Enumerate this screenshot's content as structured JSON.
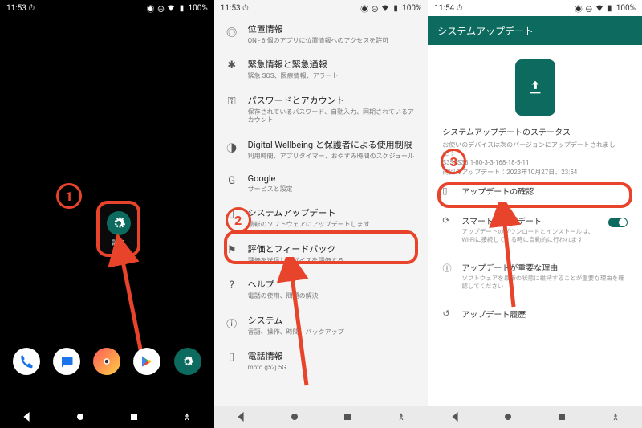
{
  "status": {
    "time1": "11:53",
    "time2": "11:53",
    "time3": "11:54",
    "battery": "100%"
  },
  "annotations": {
    "b1": "1",
    "b2": "2",
    "b3": "3"
  },
  "home": {
    "settings_label": "設定",
    "dock": [
      "phone",
      "messages",
      "camera",
      "play-store",
      "settings"
    ]
  },
  "settings_list": [
    {
      "icon": "location",
      "title": "位置情報",
      "sub": "ON - 6 個のアプリに位置情報へのアクセスを許可"
    },
    {
      "icon": "alert",
      "title": "緊急情報と緊急通報",
      "sub": "緊急 SOS、医療情報、アラート"
    },
    {
      "icon": "key",
      "title": "パスワードとアカウント",
      "sub": "保存されているパスワード、自動入力、同期されているアカウント"
    },
    {
      "icon": "wellbeing",
      "title": "Digital Wellbeing と保護者による使用制限",
      "sub": "利用時間、アプリタイマー、おやすみ時間のスケジュール"
    },
    {
      "icon": "google",
      "title": "Google",
      "sub": "サービスと設定"
    },
    {
      "icon": "phone-device",
      "title": "システムアップデート",
      "sub": "最新のソフトウェアにアップデートします"
    },
    {
      "icon": "feedback",
      "title": "評価とフィードバック",
      "sub": "評価を送信しデバイスを評価する"
    },
    {
      "icon": "help",
      "title": "ヘルプ",
      "sub": "電話の使用、問題の解決"
    },
    {
      "icon": "system",
      "title": "システム",
      "sub": "言語、操作、時間、バックアップ"
    },
    {
      "icon": "phone-info",
      "title": "電話情報",
      "sub": "moto g52j 5G"
    }
  ],
  "update": {
    "titlebar": "システムアップデート",
    "status_title": "システムアップデートのステータス",
    "status_sub1": "お使いのデバイスは次のバージョンにアップデートされました：",
    "status_sub2": "S3SJS33.1-80-3-3-168-18-5-11",
    "status_sub3": "前回のアップデート：2023年10月27日、23:54",
    "rows": [
      {
        "icon": "phone",
        "title": "アップデートの確認",
        "sub": ""
      },
      {
        "icon": "refresh",
        "title": "スマートアップデート",
        "sub": "アップデートのダウンロードとインストールは、Wi-Fiに接続している時に自動的に行われます",
        "toggle": true
      },
      {
        "icon": "info",
        "title": "アップデートが重要な理由",
        "sub": "ソフトウェアを最新の状態に維持することが重要な理由を確認してください"
      },
      {
        "icon": "history",
        "title": "アップデート履歴",
        "sub": ""
      }
    ]
  }
}
